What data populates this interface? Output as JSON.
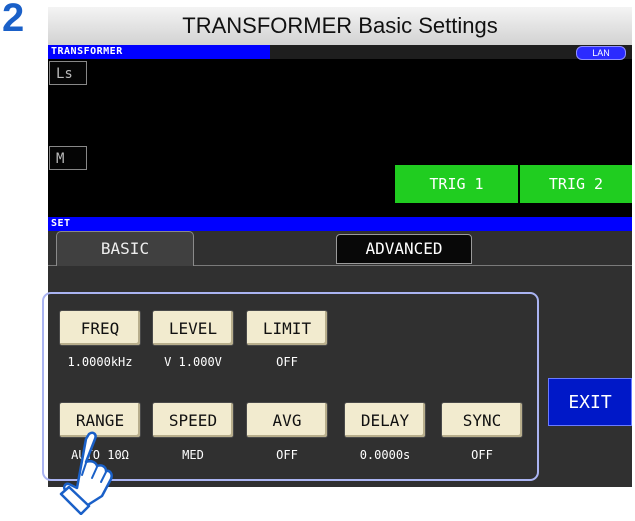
{
  "step_number": "2",
  "title": "TRANSFORMER Basic Settings",
  "header": {
    "mode_label": "TRANSFORMER",
    "lan_label": "LAN"
  },
  "params": {
    "first": "Ls",
    "second": "M"
  },
  "triggers": [
    "TRIG 1",
    "TRIG 2"
  ],
  "set_label": "SET",
  "tabs": {
    "basic": "BASIC",
    "advanced": "ADVANCED"
  },
  "buttons": {
    "freq": {
      "label": "FREQ",
      "value": "1.0000kHz"
    },
    "level": {
      "label": "LEVEL",
      "value": "V 1.000V"
    },
    "limit": {
      "label": "LIMIT",
      "value": "OFF"
    },
    "range": {
      "label": "RANGE",
      "value": "AUTO  10Ω"
    },
    "speed": {
      "label": "SPEED",
      "value": "MED"
    },
    "avg": {
      "label": "AVG",
      "value": "OFF"
    },
    "delay": {
      "label": "DELAY",
      "value": "0.0000s"
    },
    "sync": {
      "label": "SYNC",
      "value": "OFF"
    }
  },
  "exit_label": "EXIT",
  "colors": {
    "step": "#1a60c8",
    "trigger": "#20cd20",
    "header_bar": "#0000ff",
    "button": "#f2ebcf",
    "exit": "#0018c8"
  },
  "icons": {
    "hand": "pointing-hand-icon"
  }
}
